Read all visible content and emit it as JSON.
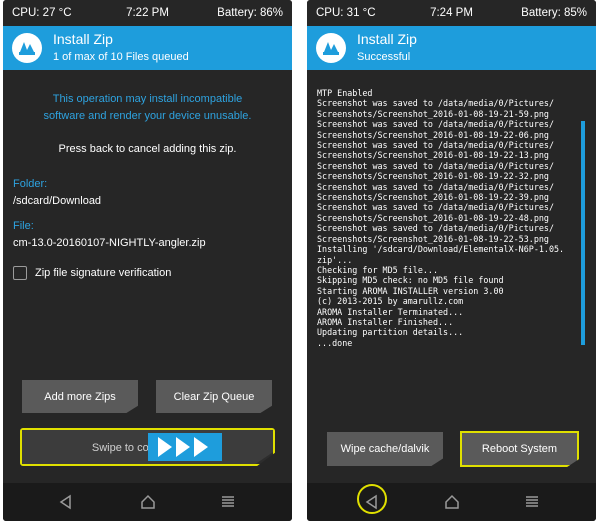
{
  "left": {
    "status": {
      "cpu": "CPU: 27 °C",
      "time": "7:22 PM",
      "battery": "Battery: 86%"
    },
    "header": {
      "title": "Install Zip",
      "subtitle": "1 of max of 10 Files queued"
    },
    "warning_line1": "This operation may install incompatible",
    "warning_line2": "software and render your device unusable.",
    "press_back": "Press back to cancel adding this zip.",
    "folder_label": "Folder:",
    "folder_value": "/sdcard/Download",
    "file_label": "File:",
    "file_value": "cm-13.0-20160107-NIGHTLY-angler.zip",
    "checkbox_label": "Zip file signature verification",
    "checkbox_checked": false,
    "add_more_label": "Add more Zips",
    "clear_queue_label": "Clear Zip Queue",
    "swipe_label": "Swipe to confirm Flash"
  },
  "right": {
    "status": {
      "cpu": "CPU: 31 °C",
      "time": "7:24 PM",
      "battery": "Battery: 85%"
    },
    "header": {
      "title": "Install Zip",
      "subtitle": "Successful"
    },
    "console_lines": [
      "MTP Enabled",
      "Screenshot was saved to /data/media/0/Pictures/",
      "Screenshots/Screenshot_2016-01-08-19-21-59.png",
      "Screenshot was saved to /data/media/0/Pictures/",
      "Screenshots/Screenshot_2016-01-08-19-22-06.png",
      "Screenshot was saved to /data/media/0/Pictures/",
      "Screenshots/Screenshot_2016-01-08-19-22-13.png",
      "Screenshot was saved to /data/media/0/Pictures/",
      "Screenshots/Screenshot_2016-01-08-19-22-32.png",
      "Screenshot was saved to /data/media/0/Pictures/",
      "Screenshots/Screenshot_2016-01-08-19-22-39.png",
      "Screenshot was saved to /data/media/0/Pictures/",
      "Screenshots/Screenshot_2016-01-08-19-22-48.png",
      "Screenshot was saved to /data/media/0/Pictures/",
      "Screenshots/Screenshot_2016-01-08-19-22-53.png",
      "Installing '/sdcard/Download/ElementalX-N6P-1.05.",
      "zip'...",
      "Checking for MD5 file...",
      "Skipping MD5 check: no MD5 file found",
      "Starting AROMA INSTALLER version 3.00",
      "(c) 2013-2015 by amarullz.com",
      "AROMA Installer Terminated...",
      "AROMA Installer Finished...",
      "Updating partition details...",
      "...done"
    ],
    "wipe_label": "Wipe cache/dalvik",
    "reboot_label": "Reboot System"
  },
  "colors": {
    "accent": "#1e9ddc",
    "highlight": "#e0e000",
    "background": "#262626"
  }
}
